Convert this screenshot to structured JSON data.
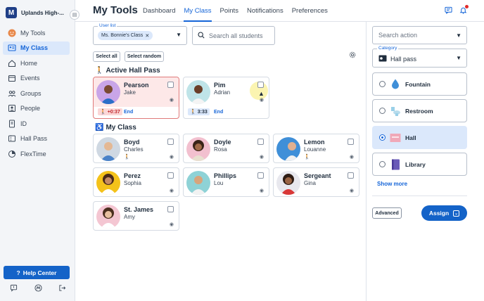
{
  "brand": {
    "logo": "M",
    "name": "Uplands High-..."
  },
  "sidebar": {
    "items": [
      {
        "label": "My Tools",
        "icon": "smiley-icon"
      },
      {
        "label": "My Class",
        "icon": "class-icon",
        "active": true
      },
      {
        "label": "Home",
        "icon": "home-icon"
      },
      {
        "label": "Events",
        "icon": "calendar-icon"
      },
      {
        "label": "Groups",
        "icon": "groups-icon"
      },
      {
        "label": "People",
        "icon": "person-icon"
      },
      {
        "label": "ID",
        "icon": "id-icon"
      },
      {
        "label": "Hall Pass",
        "icon": "hall-pass-icon"
      },
      {
        "label": "FlexTime",
        "icon": "flextime-icon"
      }
    ],
    "help_label": "Help Center"
  },
  "header": {
    "title": "My Tools",
    "tabs": [
      "Dashboard",
      "My Class",
      "Points",
      "Notifications",
      "Preferences"
    ],
    "active_tab": "My Class"
  },
  "filters": {
    "user_list_label": "User list",
    "user_list_value": "Ms. Bonnie's Class",
    "search_placeholder": "Search all students",
    "select_all": "Select all",
    "select_random": "Select random"
  },
  "active_hall_pass": {
    "title": "Active Hall Pass",
    "students": [
      {
        "last": "Pearson",
        "first": "Jake",
        "timer": "+0:37",
        "end": "End",
        "late": true
      },
      {
        "last": "Pim",
        "first": "Adrian",
        "timer": "3:33",
        "end": "End",
        "late": false
      }
    ]
  },
  "my_class": {
    "title": "My Class",
    "students": [
      {
        "last": "Boyd",
        "first": "Charles"
      },
      {
        "last": "Doyle",
        "first": "Rosa"
      },
      {
        "last": "Lemon",
        "first": "Louanne"
      },
      {
        "last": "Perez",
        "first": "Sophia"
      },
      {
        "last": "Phillips",
        "first": "Lou"
      },
      {
        "last": "Sergeant",
        "first": "Gina"
      },
      {
        "last": "St. James",
        "first": "Amy"
      }
    ]
  },
  "right_panel": {
    "search_placeholder": "Search action",
    "category_label": "Category",
    "category_value": "Hall pass",
    "locations": [
      {
        "label": "Fountain",
        "icon": "water-drop-icon"
      },
      {
        "label": "Restroom",
        "icon": "restroom-icon"
      },
      {
        "label": "Hall",
        "icon": "hall-icon",
        "selected": true
      },
      {
        "label": "Library",
        "icon": "library-icon"
      }
    ],
    "show_more": "Show more",
    "advanced": "Advanced",
    "assign": "Assign"
  },
  "colors": {
    "accent": "#1565d8",
    "alert": "#c0272d",
    "selected_bg": "#dbe8fb"
  }
}
